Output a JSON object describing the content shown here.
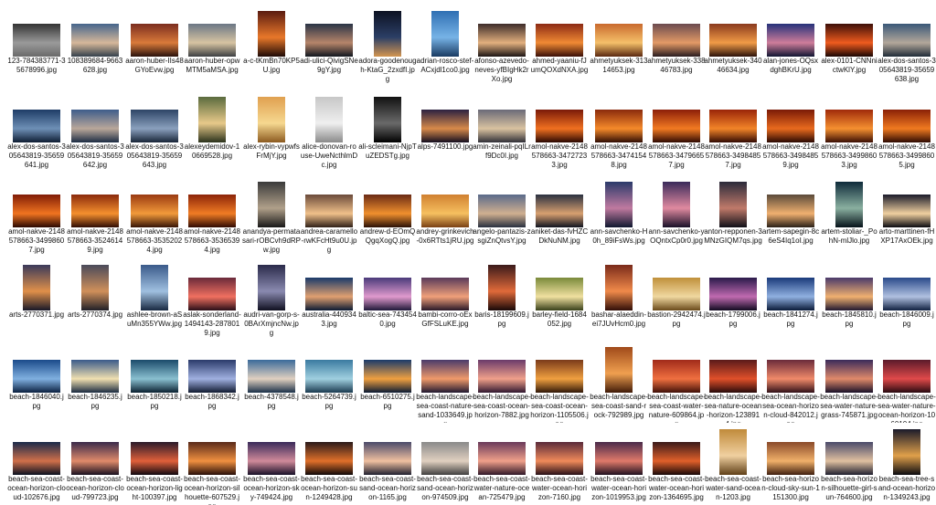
{
  "folder": {
    "items": [
      {
        "name": "123-784383771-35678996.jpg",
        "c": [
          "#333333",
          "#9a9a9a",
          "#6a6a6a"
        ],
        "o": "l"
      },
      {
        "name": "108389684-9663628.jpg",
        "c": [
          "#46658c",
          "#d6b89a",
          "#34404c"
        ],
        "o": "l"
      },
      {
        "name": "aaron-huber-IIs48GYoEvw.jpg",
        "c": [
          "#7b2d1f",
          "#d97a3a",
          "#2a120c"
        ],
        "o": "l"
      },
      {
        "name": "aaron-huber-opwMTM5aMSA.jpg",
        "c": [
          "#6b7785",
          "#d7c4a2",
          "#3c3f42"
        ],
        "o": "l"
      },
      {
        "name": "a-c-tKmBn70KP5U.jpg",
        "c": [
          "#5a1b10",
          "#e8782a",
          "#1e0a06"
        ],
        "o": "p"
      },
      {
        "name": "adi-ulici-QivigSNe9gY.jpg",
        "c": [
          "#2a3446",
          "#b6856a",
          "#121720"
        ],
        "o": "l"
      },
      {
        "name": "adora-goodenough-KtaG_2zxdfI.jpg",
        "c": [
          "#0c1122",
          "#2c3f66",
          "#d39550"
        ],
        "o": "p"
      },
      {
        "name": "adrian-rosco-stef-ACxjdl1co0.jpg",
        "c": [
          "#2f6fb3",
          "#77b3e6",
          "#1a3b62"
        ],
        "o": "p"
      },
      {
        "name": "afonso-azevedo-neves-yfBIgHk2rXo.jpg",
        "c": [
          "#3d2c2a",
          "#e3b07e",
          "#1c1514"
        ],
        "o": "l"
      },
      {
        "name": "ahmed-yaaniu-fJumQOXdNXA.jpg",
        "c": [
          "#8c2a14",
          "#f08a34",
          "#3a0e06"
        ],
        "o": "l"
      },
      {
        "name": "ahmetyuksek-31314653.jpg",
        "c": [
          "#c96a2e",
          "#f5c06a",
          "#5a2810"
        ],
        "o": "l"
      },
      {
        "name": "ahmetyuksek-33846783.jpg",
        "c": [
          "#6b4b4f",
          "#e39a66",
          "#2a1c20"
        ],
        "o": "l"
      },
      {
        "name": "ahmetyuksek-34046634.jpg",
        "c": [
          "#8a3a1e",
          "#f19b46",
          "#2c120a"
        ],
        "o": "l"
      },
      {
        "name": "alan-jones-OQsxdghBKrU.jpg",
        "c": [
          "#26327a",
          "#cf7d9a",
          "#121633"
        ],
        "o": "l"
      },
      {
        "name": "alex-0101-CNNnictwKlY.jpg",
        "c": [
          "#3d0f08",
          "#ef5b1e",
          "#1a0603"
        ],
        "o": "l"
      },
      {
        "name": "alex-dos-santos-305643819-35659638.jpg",
        "c": [
          "#3a5878",
          "#b3a79a",
          "#202c38"
        ],
        "o": "l"
      },
      {
        "name": "alex-dos-santos-305643819-35659641.jpg",
        "c": [
          "#1e3c66",
          "#6e8fb6",
          "#0e1d33"
        ],
        "o": "l"
      },
      {
        "name": "alex-dos-santos-305643819-35659642.jpg",
        "c": [
          "#3e5d8a",
          "#b9a79a",
          "#1d2d44"
        ],
        "o": "l"
      },
      {
        "name": "alex-dos-santos-305643819-35659643.jpg",
        "c": [
          "#2d4466",
          "#8aa0bd",
          "#182538"
        ],
        "o": "l"
      },
      {
        "name": "alexeydemidov-10669528.jpg",
        "c": [
          "#5a6b3e",
          "#e7c98a",
          "#2b321c"
        ],
        "o": "p"
      },
      {
        "name": "alex-rybin-vypwfsFrMjY.jpg",
        "c": [
          "#e0a050",
          "#f6d890",
          "#8c5a20"
        ],
        "o": "p"
      },
      {
        "name": "alice-donovan-rouse-UweNcthlmDc.jpg",
        "c": [
          "#c7c7c7",
          "#efefef",
          "#8a8a8a"
        ],
        "o": "p"
      },
      {
        "name": "ali-scleimani-NjpTuZEDSTg.jpg",
        "c": [
          "#111111",
          "#6a6a6a",
          "#000000"
        ],
        "o": "p"
      },
      {
        "name": "alps-7491100.jpg",
        "c": [
          "#2b2040",
          "#d78a4a",
          "#140e1f"
        ],
        "o": "l"
      },
      {
        "name": "amin-zeinali-pqILrf9Dc0I.jpg",
        "c": [
          "#6a6a78",
          "#d9c2a0",
          "#303038"
        ],
        "o": "l"
      },
      {
        "name": "amol-nakve-2148578663-34727233.jpg",
        "c": [
          "#7a1a08",
          "#f07020",
          "#2a0802"
        ],
        "o": "l"
      },
      {
        "name": "amol-nakve-2148578663-34741548.jpg",
        "c": [
          "#8a2a0c",
          "#f58a2a",
          "#300d04"
        ],
        "o": "l"
      },
      {
        "name": "amol-nakve-2148578663-34796657.jpg",
        "c": [
          "#8c1e08",
          "#f27a22",
          "#300a02"
        ],
        "o": "l"
      },
      {
        "name": "amol-nakve-2148578663-34984857.jpg",
        "c": [
          "#9a2408",
          "#f28428",
          "#320a02"
        ],
        "o": "l"
      },
      {
        "name": "amol-nakve-2148578663-34984859.jpg",
        "c": [
          "#7a1a06",
          "#e86a1e",
          "#2a0802"
        ],
        "o": "l"
      },
      {
        "name": "amol-nakve-2148578663-34998603.jpg",
        "c": [
          "#a02a0a",
          "#f59030",
          "#3a0e04"
        ],
        "o": "l"
      },
      {
        "name": "amol-nakve-2148578663-34998605.jpg",
        "c": [
          "#8a2006",
          "#f07a20",
          "#2e0a02"
        ],
        "o": "l"
      },
      {
        "name": "amol-nakve-2148578663-34998607.jpg",
        "c": [
          "#801c06",
          "#f07420",
          "#2a0802"
        ],
        "o": "l"
      },
      {
        "name": "amol-nakve-2148578663-35246149.jpg",
        "c": [
          "#8a2a0c",
          "#f5902e",
          "#300d04"
        ],
        "o": "l"
      },
      {
        "name": "amol-nakve-2148578663-35352024.jpg",
        "c": [
          "#9a3a12",
          "#f29a3a",
          "#361406"
        ],
        "o": "l"
      },
      {
        "name": "amol-nakve-2148578663-35365394.jpg",
        "c": [
          "#8c2408",
          "#f07c24",
          "#300a02"
        ],
        "o": "l"
      },
      {
        "name": "anandya-permatasari-rOBCvh9dRPw.jpg",
        "c": [
          "#3a3a3a",
          "#b0a08a",
          "#181818"
        ],
        "o": "p"
      },
      {
        "name": "andrea-caramello-rwKFcHt9u0U.jpg",
        "c": [
          "#6a4a3a",
          "#f0c08a",
          "#302018"
        ],
        "o": "l"
      },
      {
        "name": "andrew-d-EOmQQgqXogQ.jpg",
        "c": [
          "#6a2a14",
          "#f0902e",
          "#2a1006"
        ],
        "o": "l"
      },
      {
        "name": "andrey-grinkevich-0x6RTts1jRU.jpg",
        "c": [
          "#d08030",
          "#f6c060",
          "#7a4014"
        ],
        "o": "l"
      },
      {
        "name": "angelo-pantazis-zsgiZnQtvsY.jpg",
        "c": [
          "#5a6a8a",
          "#d0b090",
          "#283040"
        ],
        "o": "l"
      },
      {
        "name": "aniket-das-fvHZCDkNuNM.jpg",
        "c": [
          "#2a3040",
          "#d8a070",
          "#101420"
        ],
        "o": "l"
      },
      {
        "name": "ann-savchenko-H0h_89iFsWs.jpg",
        "c": [
          "#2a3a6a",
          "#c07aa0",
          "#101830"
        ],
        "o": "p"
      },
      {
        "name": "ann-savchenko-yOQntxCp0r0.jpg",
        "c": [
          "#3a2a5a",
          "#e08aa0",
          "#181028"
        ],
        "o": "p"
      },
      {
        "name": "anton-repponen-3MNzGIQM7qs.jpg",
        "c": [
          "#2a2a3a",
          "#c07a6a",
          "#101018"
        ],
        "o": "p"
      },
      {
        "name": "artem-sapegin-8c6eS4Iq1oI.jpg",
        "c": [
          "#5a4a3a",
          "#f0b070",
          "#2a2018"
        ],
        "o": "l"
      },
      {
        "name": "artem-stoliar-_PohN-mlJlo.jpg",
        "c": [
          "#0e2a3a",
          "#8ab0a0",
          "#06121a"
        ],
        "o": "p"
      },
      {
        "name": "arto-marttinen-fHXP17AxOEk.jpg",
        "c": [
          "#1a1a2a",
          "#f0d0a0",
          "#0a0a10"
        ],
        "o": "l"
      },
      {
        "name": "arts-2770371.jpg",
        "c": [
          "#3a3a5a",
          "#e0904a",
          "#181828"
        ],
        "o": "p"
      },
      {
        "name": "arts-2770374.jpg",
        "c": [
          "#4a4a5a",
          "#d0905a",
          "#202028"
        ],
        "o": "p"
      },
      {
        "name": "ashlee-brown-aSuMn355YWw.jpg",
        "c": [
          "#3a5a8a",
          "#a0c0e0",
          "#182840"
        ],
        "o": "p"
      },
      {
        "name": "aslak-sonderland-1494143-2878019.jpg",
        "c": [
          "#6a2a3a",
          "#f07060",
          "#2a0e18"
        ],
        "o": "l"
      },
      {
        "name": "audri-van-gorp-s-0BArXmjncNw.jpg",
        "c": [
          "#2a2a4a",
          "#8a8ab0",
          "#101020"
        ],
        "o": "p"
      },
      {
        "name": "australia-4409343.jpg",
        "c": [
          "#1a3a6a",
          "#e0a070",
          "#0a1a33"
        ],
        "o": "l"
      },
      {
        "name": "baltic-sea-7434540.jpg",
        "c": [
          "#4a3a7a",
          "#e09acd",
          "#1e1838"
        ],
        "o": "l"
      },
      {
        "name": "bambi-corro-oExGfFSLuKE.jpg",
        "c": [
          "#5a3a5a",
          "#f0a07a",
          "#281828"
        ],
        "o": "l"
      },
      {
        "name": "baris-18199609.jpg",
        "c": [
          "#3a1a1a",
          "#e06a3a",
          "#180808"
        ],
        "o": "p"
      },
      {
        "name": "barley-field-1684052.jpg",
        "c": [
          "#7a8a3a",
          "#f0e0a0",
          "#38401a"
        ],
        "o": "l"
      },
      {
        "name": "bashar-alaeddin-ei7JUvHcm0.jpg",
        "c": [
          "#7a2a1a",
          "#f08a4a",
          "#300e08"
        ],
        "o": "p"
      },
      {
        "name": "bastion-2942474.jpg",
        "c": [
          "#c0903a",
          "#f0d8a0",
          "#6a4a1a"
        ],
        "o": "l"
      },
      {
        "name": "beach-1799006.jpg",
        "c": [
          "#2a1a4a",
          "#c06ab0",
          "#100a20"
        ],
        "o": "l"
      },
      {
        "name": "beach-1841274.jpg",
        "c": [
          "#1a3a7a",
          "#90b0e0",
          "#0a1a38"
        ],
        "o": "l"
      },
      {
        "name": "beach-1845810.jpg",
        "c": [
          "#4a3a6a",
          "#f0b070",
          "#201830"
        ],
        "o": "l"
      },
      {
        "name": "beach-1846009.jpg",
        "c": [
          "#2a4a8a",
          "#b0c0e0",
          "#102040"
        ],
        "o": "l"
      },
      {
        "name": "beach-1846040.jpg",
        "c": [
          "#1a4a8a",
          "#80b0e0",
          "#0a2040"
        ],
        "o": "l"
      },
      {
        "name": "beach-1846235.jpg",
        "c": [
          "#3a5a8a",
          "#f0e0b0",
          "#1a2a40"
        ],
        "o": "l"
      },
      {
        "name": "beach-1850218.jpg",
        "c": [
          "#1a4a6a",
          "#8ac0d0",
          "#0a2030"
        ],
        "o": "l"
      },
      {
        "name": "beach-1868342.jpg",
        "c": [
          "#2a3a6a",
          "#a0b0e0",
          "#101a30"
        ],
        "o": "l"
      },
      {
        "name": "beach-4378548.jpg",
        "c": [
          "#3a6a9a",
          "#e0d0c0",
          "#1a3048"
        ],
        "o": "l"
      },
      {
        "name": "beach-5264739.jpg",
        "c": [
          "#3a7aa0",
          "#a0d0e0",
          "#1a3a50"
        ],
        "o": "l"
      },
      {
        "name": "beach-6510275.jpg",
        "c": [
          "#1a3a6a",
          "#f0a040",
          "#0a1a33"
        ],
        "o": "l"
      },
      {
        "name": "beach-landscape-sea-coast-nature-sand-1033649.jpg",
        "c": [
          "#4a3a6a",
          "#f09a6a",
          "#201830"
        ],
        "o": "l"
      },
      {
        "name": "beach-landscape-sea-coast-ocean-horizon-7882.jpg",
        "c": [
          "#6a3a6a",
          "#f0a08a",
          "#301830"
        ],
        "o": "l"
      },
      {
        "name": "beach-landscape-sea-coast-ocean-horizon-1105506.jpg",
        "c": [
          "#7a3a1a",
          "#f0a040",
          "#301808"
        ],
        "o": "l"
      },
      {
        "name": "beach-landscape-sea-coast-sand-rock-792989.jpg",
        "c": [
          "#a04a1a",
          "#f0a050",
          "#401a08"
        ],
        "o": "p"
      },
      {
        "name": "beach-landscape-sea-coast-water-nature-609864.jpg",
        "c": [
          "#a02a1a",
          "#f07040",
          "#401008"
        ],
        "o": "l"
      },
      {
        "name": "beach-landscape-sea-nature-ocean-horizon-1238914.jpg",
        "c": [
          "#5a1a1a",
          "#e0502a",
          "#280a0a"
        ],
        "o": "l"
      },
      {
        "name": "beach-landscape-sea-ocean-horizon-cloud-842012.jpg",
        "c": [
          "#6a2a3a",
          "#f08a6a",
          "#301018"
        ],
        "o": "l"
      },
      {
        "name": "beach-landscape-sea-water-nature-grass-745871.jpg",
        "c": [
          "#3a2a5a",
          "#e08a6a",
          "#181028"
        ],
        "o": "l"
      },
      {
        "name": "beach-landscape-sea-water-nature-ocean-horizon-1060104.jpg",
        "c": [
          "#5a1a2a",
          "#e04a4a",
          "#280a10"
        ],
        "o": "l"
      },
      {
        "name": "beach-sea-coast-ocean-horizon-cloud-102676.jpg",
        "c": [
          "#1a2a4a",
          "#d0704a",
          "#0a1020"
        ],
        "o": "l"
      },
      {
        "name": "beach-sea-coast-ocean-horizon-cloud-799723.jpg",
        "c": [
          "#3a2a4a",
          "#e08a6a",
          "#181020"
        ],
        "o": "l"
      },
      {
        "name": "beach-sea-coast-ocean-horizon-light-100397.jpg",
        "c": [
          "#2a1a2a",
          "#e0603a",
          "#100810"
        ],
        "o": "l"
      },
      {
        "name": "beach-sea-coast-ocean-horizon-silhouette-607529.jpg",
        "c": [
          "#5a2a1a",
          "#f09040",
          "#280e08"
        ],
        "o": "l"
      },
      {
        "name": "beach-sea-coast-ocean-horizon-sky-749424.jpg",
        "c": [
          "#3a2a5a",
          "#d08a9a",
          "#181028"
        ],
        "o": "l"
      },
      {
        "name": "beach-sea-coast-ocean-horizon-sun-1249428.jpg",
        "c": [
          "#2a1a1a",
          "#e0702a",
          "#100808"
        ],
        "o": "l"
      },
      {
        "name": "beach-sea-coast-sand-ocean-horizon-1165.jpg",
        "c": [
          "#4a4a6a",
          "#f0c0a0",
          "#202030"
        ],
        "o": "l"
      },
      {
        "name": "beach-sea-coast-sand-ocean-horizon-974509.jpg",
        "c": [
          "#8a8a8a",
          "#e0d0c0",
          "#404040"
        ],
        "o": "l"
      },
      {
        "name": "beach-sea-coast-water-nature-ocean-725479.jpg",
        "c": [
          "#6a3a5a",
          "#f0a08a",
          "#301828"
        ],
        "o": "l"
      },
      {
        "name": "beach-sea-coast-water-ocean-horizon-7160.jpg",
        "c": [
          "#5a2a3a",
          "#f08a5a",
          "#281018"
        ],
        "o": "l"
      },
      {
        "name": "beach-sea-coast-water-ocean-horizon-1019953.jpg",
        "c": [
          "#4a2a4a",
          "#e07a6a",
          "#201020"
        ],
        "o": "l"
      },
      {
        "name": "beach-sea-coast-water-ocean-horizon-1364695.jpg",
        "c": [
          "#3a1a1a",
          "#e0602a",
          "#180808"
        ],
        "o": "l"
      },
      {
        "name": "beach-sea-coast-water-sand-ocean-1203.jpg",
        "c": [
          "#c08a3a",
          "#f0d0a0",
          "#604018"
        ],
        "o": "p"
      },
      {
        "name": "beach-sea-horizon-cloud-sky-sun-1151300.jpg",
        "c": [
          "#8a4a2a",
          "#f0b06a",
          "#402010"
        ],
        "o": "l"
      },
      {
        "name": "beach-sea-horizon-silhouette-girl-sun-764600.jpg",
        "c": [
          "#4a4a6a",
          "#e0c0a0",
          "#202030"
        ],
        "o": "l"
      },
      {
        "name": "beach-sea-tree-sand-ocean-horizon-1349243.jpg",
        "c": [
          "#1a1a2a",
          "#e0a04a",
          "#0a0a10"
        ],
        "o": "p"
      }
    ]
  }
}
